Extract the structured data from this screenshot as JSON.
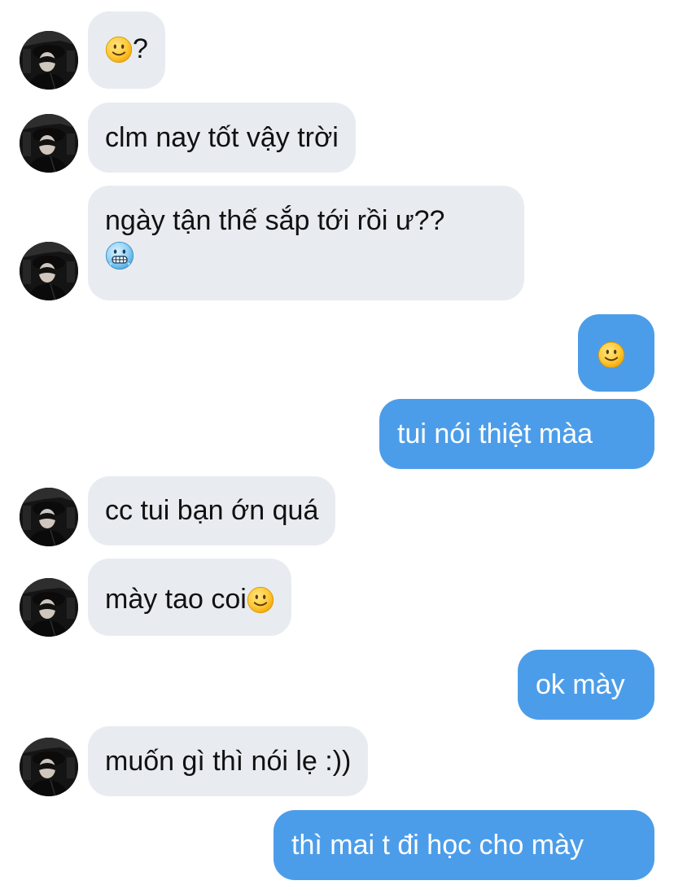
{
  "colors": {
    "incoming_bubble": "#e8ecf1",
    "outgoing_bubble": "#4c9de9",
    "incoming_text": "#111111",
    "outgoing_text": "#ffffff"
  },
  "messages": [
    {
      "side": "incoming",
      "text": "",
      "emoji_after": "slightly-smiling-face",
      "suffix": "?"
    },
    {
      "side": "incoming",
      "text": "clm nay tốt vậy trời"
    },
    {
      "side": "incoming",
      "text": "ngày tận thế sắp tới rồi ư??",
      "emoji_line": "cold-face"
    },
    {
      "side": "outgoing",
      "text": "",
      "emoji_after": "slightly-smiling-face"
    },
    {
      "side": "outgoing",
      "text": "tui nói thiệt màa"
    },
    {
      "side": "incoming",
      "text": "cc tui bạn ớn quá"
    },
    {
      "side": "incoming",
      "text": "mày tao coi",
      "emoji_after": "slightly-smiling-face"
    },
    {
      "side": "outgoing",
      "text": "ok mày"
    },
    {
      "side": "incoming",
      "text": "muốn gì thì nói lẹ :))"
    },
    {
      "side": "outgoing",
      "text": "thì mai t đi học cho mày"
    }
  ]
}
